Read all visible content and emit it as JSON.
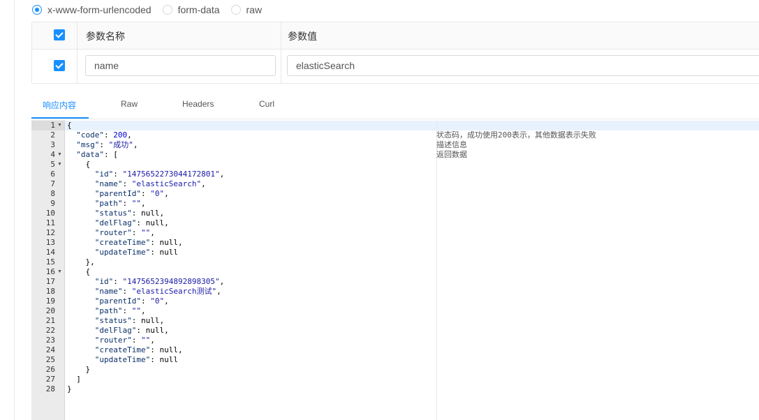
{
  "body_types": [
    {
      "label": "x-www-form-urlencoded",
      "checked": true
    },
    {
      "label": "form-data",
      "checked": false
    },
    {
      "label": "raw",
      "checked": false
    }
  ],
  "params": {
    "headers": {
      "name": "参数名称",
      "value": "参数值"
    },
    "rows": [
      {
        "name": "name",
        "value": "elasticSearch",
        "checked": true
      }
    ]
  },
  "tabs": [
    {
      "label": "响应内容",
      "active": true
    },
    {
      "label": "Raw",
      "active": false
    },
    {
      "label": "Headers",
      "active": false
    },
    {
      "label": "Curl",
      "active": false
    }
  ],
  "response": {
    "lines": [
      {
        "n": "1",
        "fold": true,
        "text": "{"
      },
      {
        "n": "2",
        "text": "  \"code\": 200,"
      },
      {
        "n": "3",
        "text": "  \"msg\": \"成功\","
      },
      {
        "n": "4",
        "fold": true,
        "text": "  \"data\": ["
      },
      {
        "n": "5",
        "fold": true,
        "text": "    {"
      },
      {
        "n": "6",
        "text": "      \"id\": \"1475652273044172801\","
      },
      {
        "n": "7",
        "text": "      \"name\": \"elasticSearch\","
      },
      {
        "n": "8",
        "text": "      \"parentId\": \"0\","
      },
      {
        "n": "9",
        "text": "      \"path\": \"\","
      },
      {
        "n": "10",
        "text": "      \"status\": null,"
      },
      {
        "n": "11",
        "text": "      \"delFlag\": null,"
      },
      {
        "n": "12",
        "text": "      \"router\": \"\","
      },
      {
        "n": "13",
        "text": "      \"createTime\": null,"
      },
      {
        "n": "14",
        "text": "      \"updateTime\": null"
      },
      {
        "n": "15",
        "text": "    },"
      },
      {
        "n": "16",
        "fold": true,
        "text": "    {"
      },
      {
        "n": "17",
        "text": "      \"id\": \"1475652394892898305\","
      },
      {
        "n": "18",
        "text": "      \"name\": \"elasticSearch测试\","
      },
      {
        "n": "19",
        "text": "      \"parentId\": \"0\","
      },
      {
        "n": "20",
        "text": "      \"path\": \"\","
      },
      {
        "n": "21",
        "text": "      \"status\": null,"
      },
      {
        "n": "22",
        "text": "      \"delFlag\": null,"
      },
      {
        "n": "23",
        "text": "      \"router\": \"\","
      },
      {
        "n": "24",
        "text": "      \"createTime\": null,"
      },
      {
        "n": "25",
        "text": "      \"updateTime\": null"
      },
      {
        "n": "26",
        "text": "    }"
      },
      {
        "n": "27",
        "text": "  ]"
      },
      {
        "n": "28",
        "text": "}"
      }
    ],
    "comments": [
      {
        "line": "2",
        "text": "状态码，成功使用200表示，其他数据表示失败"
      },
      {
        "line": "3",
        "text": "描述信息"
      },
      {
        "line": "4",
        "text": "返回数据"
      }
    ]
  },
  "colors": {
    "accent": "#1890ff",
    "key": "#0a3069",
    "string": "#1a1aa6",
    "number": "#0000cd"
  }
}
